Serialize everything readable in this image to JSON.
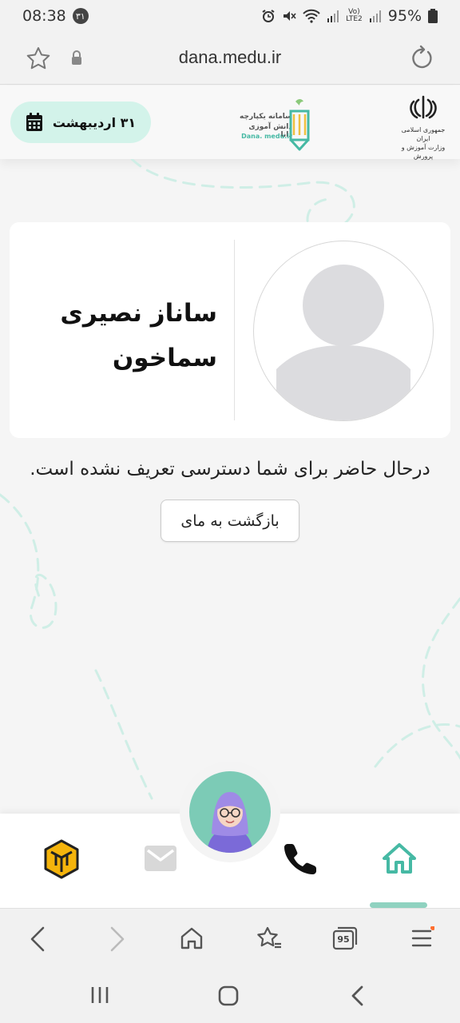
{
  "status_bar": {
    "time": "08:38",
    "notification_badge": "۳۱",
    "network_label_top": "Vo)",
    "network_label_bottom": "LTE2",
    "battery": "95%"
  },
  "browser": {
    "url": "dana.medu.ir",
    "tab_count": "95",
    "icons": [
      "star-icon",
      "lock-icon",
      "reload-icon",
      "back-icon",
      "forward-icon",
      "home-icon",
      "bookmarks-icon",
      "tabs-icon",
      "menu-icon"
    ]
  },
  "header": {
    "date": "۳۱ اردیبهشت",
    "dana_logo_line1": "سامانه یکپارچه",
    "dana_logo_line2": "دانش آموزی دانا",
    "dana_logo_url": "Dana. medu.ir",
    "gov_logo_line1": "جمهوری اسلامی ایران",
    "gov_logo_line2": "وزارت آموزش و پرورش"
  },
  "profile": {
    "first_name": "ساناز نصیری",
    "last_name": "سماخون"
  },
  "notice": "درحال حاضر برای شما دسترسی تعریف نشده است.",
  "back_button": "بازگشت به مای",
  "bottom_nav": {
    "items": [
      "cube-icon",
      "mail-icon",
      "assistant-avatar",
      "phone-icon",
      "home-icon"
    ],
    "active": "home"
  },
  "colors": {
    "accent": "#46b9a4",
    "accent_light": "#d3f3ea",
    "fab": "#7ccbb6",
    "cube": "#f5b40c"
  }
}
